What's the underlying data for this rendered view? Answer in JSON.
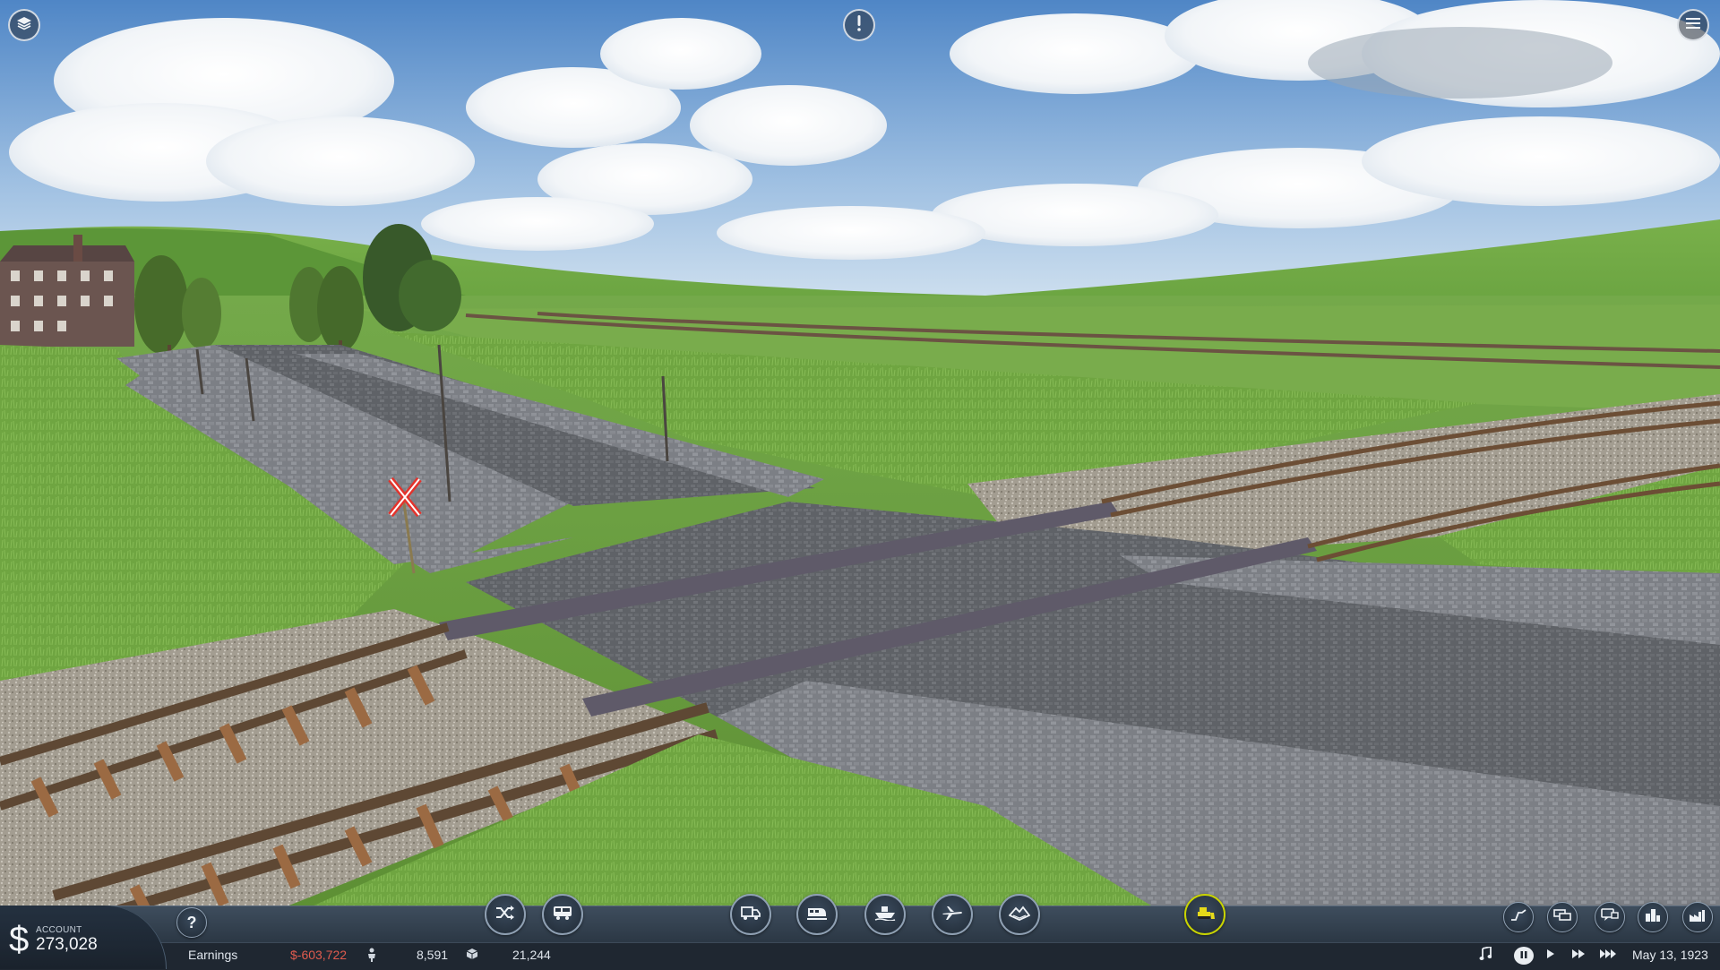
{
  "scene": {
    "description_icon": "landscape-scene"
  },
  "top_overlay": {
    "layers_icon": "layers-icon",
    "alert_icon": "exclamation-icon",
    "menu_icon": "hamburger-menu-icon"
  },
  "hud": {
    "account": {
      "currency_symbol": "$",
      "label": "ACCOUNT",
      "value": "273,028"
    },
    "help_label": "?",
    "toolbar_left": [
      {
        "name": "line-manager",
        "icon": "shuffle-icon"
      },
      {
        "name": "vehicle-manager",
        "icon": "bus-icon"
      }
    ],
    "toolbar_center": [
      {
        "name": "road",
        "icon": "truck-icon"
      },
      {
        "name": "rail",
        "icon": "train-icon"
      },
      {
        "name": "water",
        "icon": "ship-icon"
      },
      {
        "name": "air",
        "icon": "airplane-icon"
      },
      {
        "name": "terrain",
        "icon": "terrain-icon"
      }
    ],
    "bulldozer_icon": "bulldozer-icon",
    "toolbar_right": [
      {
        "name": "stats",
        "icon": "chart-line-icon"
      },
      {
        "name": "vehicles-list",
        "icon": "wagons-icon"
      },
      {
        "name": "messages",
        "icon": "speech-icon"
      },
      {
        "name": "cities",
        "icon": "city-icon"
      },
      {
        "name": "industries",
        "icon": "factory-icon"
      }
    ],
    "stats": {
      "earnings_label": "Earnings",
      "earnings_value": "$-603,722",
      "passengers_value": "8,591",
      "cargo_value": "21,244"
    },
    "date": "May 13, 1923",
    "colors": {
      "negative": "#e05b4e",
      "active_ring": "#c9d400",
      "hud_bg": "#2b3744"
    }
  }
}
